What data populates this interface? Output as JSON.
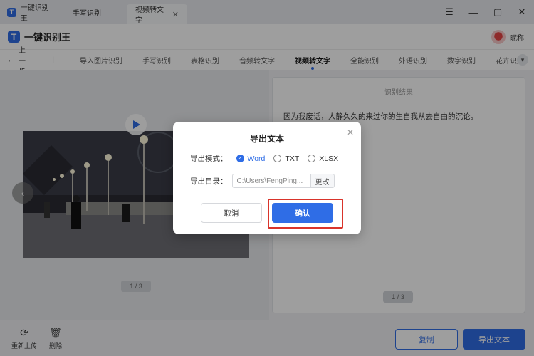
{
  "titlebar": {
    "tabs": [
      {
        "label": "一键识别王"
      },
      {
        "label": "手写识别"
      },
      {
        "label": "视频转文字"
      }
    ],
    "close_tab_glyph": "✕",
    "controls": {
      "menu": "☰",
      "minimize": "—",
      "maximize": "▢",
      "close": "✕"
    }
  },
  "header": {
    "app_name": "一键识别王",
    "logo_text": "T",
    "user_name": "昵称"
  },
  "nav": {
    "back_label": "上一步",
    "items": [
      {
        "label": "导入图片识别"
      },
      {
        "label": "手写识别"
      },
      {
        "label": "表格识别"
      },
      {
        "label": "音频转文字"
      },
      {
        "label": "视频转文字",
        "active": true
      },
      {
        "label": "全能识别"
      },
      {
        "label": "外语识别"
      },
      {
        "label": "数字识别"
      },
      {
        "label": "花卉识别"
      }
    ],
    "more_glyph": "▾"
  },
  "left": {
    "pager": "1 / 3"
  },
  "right": {
    "title": "识别结果",
    "text": "因为我废话，人静久久的来过你的生自我从去自由的沉论。",
    "pager": "1 / 3"
  },
  "bottom": {
    "reupload_label": "重新上传",
    "delete_label": "删除",
    "copy_label": "复制",
    "export_label": "导出文本"
  },
  "dialog": {
    "title": "导出文本",
    "mode_label": "导出模式：",
    "modes": [
      {
        "label": "Word",
        "selected": true
      },
      {
        "label": "TXT",
        "selected": false
      },
      {
        "label": "XLSX",
        "selected": false
      }
    ],
    "dir_label": "导出目录：",
    "dir_value": "C:\\Users\\FengPing...",
    "change_label": "更改",
    "cancel_label": "取消",
    "confirm_label": "确认"
  },
  "colors": {
    "accent": "#2f6de6",
    "highlight": "#d9342b"
  }
}
